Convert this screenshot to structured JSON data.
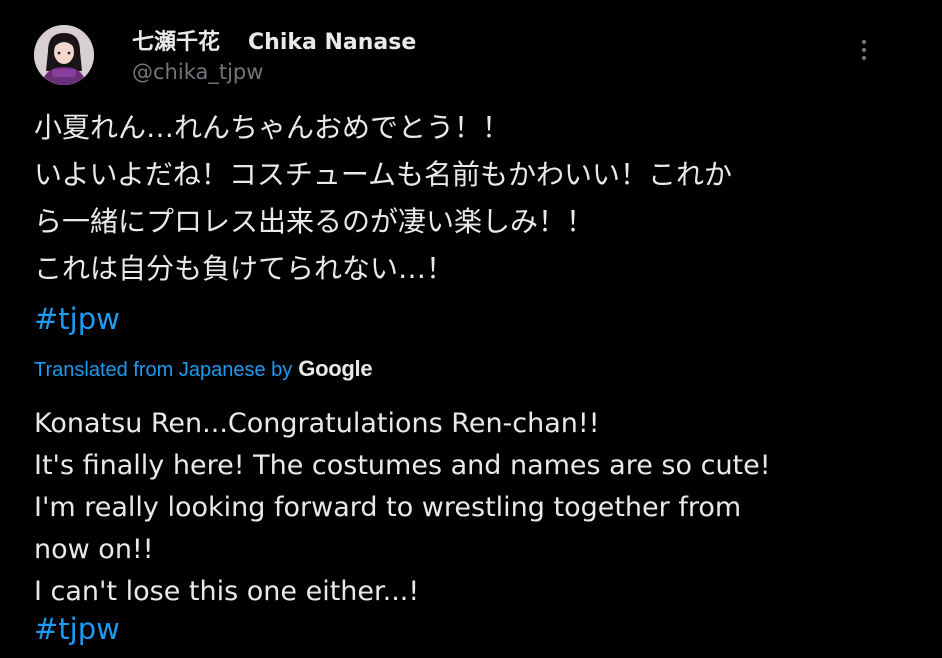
{
  "author": {
    "display_name_jp": "七瀬千花",
    "display_name_en": "Chika Nanase",
    "handle": "@chika_tjpw"
  },
  "post": {
    "original_lines": [
      "小夏れん…れんちゃんおめでとう！！",
      "いよいよだね！コスチュームも名前もかわいい！これか",
      "ら一緒にプロレス出来るのが凄い楽しみ！！",
      "これは自分も負けてられない…！"
    ],
    "original_hashtag": "#tjpw",
    "translation_label": "Translated from Japanese by",
    "translation_provider": "Google",
    "translated_lines": [
      "Konatsu Ren...Congratulations Ren-chan!!",
      "It's finally here! The costumes and names are so cute!",
      "I'm really looking forward to wrestling together from",
      "now on!!",
      "I can't lose this one either...!"
    ],
    "translated_hashtag": "#tjpw"
  },
  "icons": {
    "more": "more-vertical-icon",
    "avatar": "avatar"
  },
  "colors": {
    "background": "#000000",
    "text": "#e7e9ea",
    "secondary": "#71767b",
    "link": "#1d9bf0"
  }
}
